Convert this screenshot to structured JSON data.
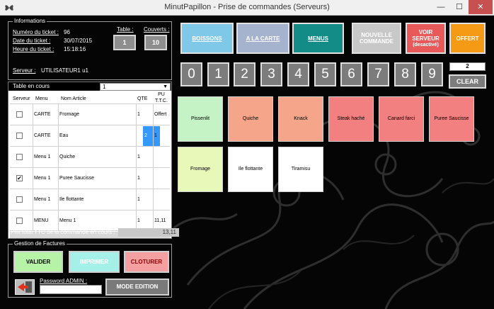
{
  "window": {
    "title": "MinutPapillon - Prise de commandes (Serveurs)",
    "min": "—",
    "max": "☐",
    "close": "✕"
  },
  "info": {
    "legend": "Informations",
    "ticket_label": "Numéro du ticket :",
    "ticket_value": "96",
    "date_label": "Date du ticket :",
    "date_value": "30/07/2015",
    "heure_label": "Heure du ticket :",
    "heure_value": "15:18:16",
    "table_label": "Table :",
    "table_value": "1",
    "couverts_label": "Couverts :",
    "couverts_value": "10",
    "serveur_label": "Serveur :",
    "serveur_value": "UTILISATEUR1 u1"
  },
  "table": {
    "header": "Table en cours",
    "selected_table": "1",
    "columns": [
      "Serveur",
      "Menu",
      "Nom Article",
      "QTE",
      "PU T.T.C."
    ],
    "rows": [
      {
        "checked": false,
        "menu": "CARTE",
        "article": "Fromage",
        "qte": "1",
        "pu": "Offert"
      },
      {
        "checked": false,
        "menu": "CARTE",
        "article": "Eau",
        "qte": "2",
        "pu": "1"
      },
      {
        "checked": false,
        "menu": "Menu 1",
        "article": "Quiche",
        "qte": "1",
        "pu": ""
      },
      {
        "checked": true,
        "menu": "Menu 1",
        "article": "Puree Saucisse",
        "qte": "1",
        "pu": ""
      },
      {
        "checked": false,
        "menu": "Menu 1",
        "article": "Ile flottante",
        "qte": "1",
        "pu": ""
      },
      {
        "checked": false,
        "menu": "MENU",
        "article": "Menu 1",
        "qte": "1",
        "pu": "11,11"
      }
    ]
  },
  "total": {
    "label": "Prix total TTC de la commande en cours :",
    "value": "13,11"
  },
  "factures": {
    "legend": "Gestion de Factures",
    "valider": "VALIDER",
    "imprimer": "IMPRIMER",
    "cloturer": "CLOTURER",
    "password_label": "Password ADMIN :",
    "mode_edition": "MODE EDITION"
  },
  "categories": {
    "boissons": "BOISSONS",
    "carte": "A LA CARTE",
    "menus": "MENUS",
    "nouvelle": "NOUVELLE COMMANDE",
    "voir_serveur": "VOIR SERVEUR",
    "voir_serveur_sub": "(desactivé)",
    "offert": "OFFERT"
  },
  "keypad": {
    "digits": [
      "0",
      "1",
      "2",
      "3",
      "4",
      "5",
      "6",
      "7",
      "8",
      "9"
    ],
    "qty_display": "2",
    "clear": "CLEAR"
  },
  "products": [
    "Pissenlit",
    "Quiche",
    "Knack",
    "Steak haché",
    "Canard farci",
    "Puree Saucisse",
    "Fromage",
    "Ile flottante",
    "Tiramisu"
  ],
  "colors": {
    "boissons": "#7fc8e8",
    "carte": "#a5b3cf",
    "menus": "#138b87",
    "nouvelle": "#c8c8c8",
    "voir_serveur": "#e85a5a",
    "offert": "#f59a14",
    "pissenlit": "#c6f3c6",
    "quiche": "#f4a58a",
    "knack": "#f4a58a",
    "red_items": "#f28080",
    "fromage": "#e8f8b8",
    "white_items": "#ffffff"
  }
}
